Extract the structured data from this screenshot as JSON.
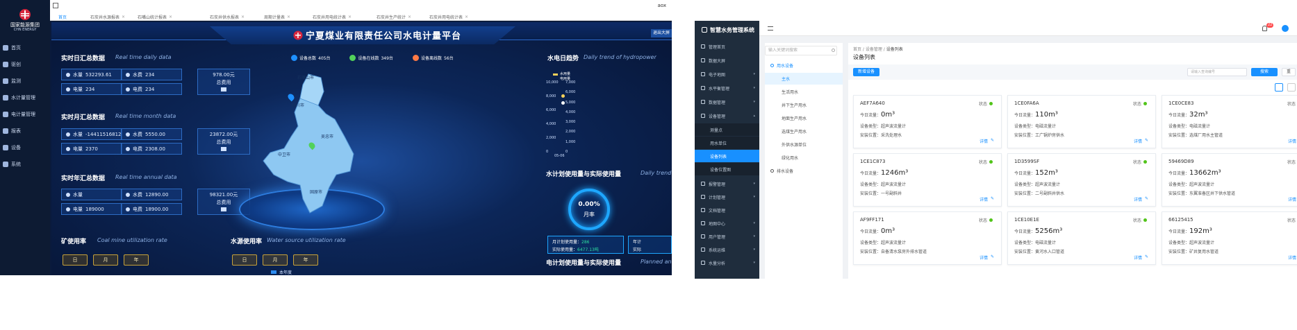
{
  "left_app": {
    "brand": {
      "logo_cn": "国家能源集团",
      "logo_en": "CHN ENERGY"
    },
    "nav": [
      {
        "label": "首页",
        "icon": "home-icon"
      },
      {
        "label": "驱创",
        "icon": "gear-icon"
      },
      {
        "label": "监测",
        "icon": "monitor-icon"
      },
      {
        "label": "水计量管理",
        "icon": "drop-icon"
      },
      {
        "label": "电计量管理",
        "icon": "meter-icon"
      },
      {
        "label": "报表",
        "icon": "report-icon"
      },
      {
        "label": "设备",
        "icon": "device-icon"
      },
      {
        "label": "系统",
        "icon": "system-icon"
      }
    ],
    "tabs": [
      {
        "label": "首页"
      },
      {
        "label": "石炭井水源报表"
      },
      {
        "label": "石嘴山统计报表"
      },
      {
        "label": "石炭井供水报表"
      },
      {
        "label": "周期计量表"
      },
      {
        "label": "石炭井用电统计表"
      },
      {
        "label": "石炭井生产统计"
      },
      {
        "label": "石炭井用电统计表"
      }
    ],
    "top_right_text": "aox",
    "dashboard": {
      "title": "宁夏煤业有限责任公司水电计量平台",
      "top_right_button": "退出大屏",
      "device_stats": [
        {
          "label": "设备总数",
          "value": "405台",
          "color": "#1e90ff"
        },
        {
          "label": "设备在线数",
          "value": "349台",
          "color": "#52d15a"
        },
        {
          "label": "设备离线数",
          "value": "56台",
          "color": "#ff7a45"
        }
      ],
      "daily": {
        "title": "实时日汇总数据",
        "subtitle": "Real time daily data",
        "water_label": "水量",
        "water_value": "532293.61",
        "water_fee_label": "水费",
        "water_fee_value": "234",
        "power_label": "电量",
        "power_value": "234",
        "power_fee_label": "电费",
        "power_fee_value": "234",
        "total_value": "978.00元",
        "total_label": "总费用"
      },
      "monthly": {
        "title": "实时月汇总数据",
        "subtitle": "Real time month data",
        "water_label": "水量",
        "water_value": "-14411516812",
        "water_fee_label": "水费",
        "water_fee_value": "5550.00",
        "power_label": "电量",
        "power_value": "2370",
        "power_fee_label": "电费",
        "power_fee_value": "2308.00",
        "total_value": "23872.00元",
        "total_label": "总费用"
      },
      "annual": {
        "title": "实时年汇总数据",
        "subtitle": "Real time annual data",
        "water_label": "水量",
        "water_value": "",
        "water_fee_label": "水费",
        "water_fee_value": "12890.00",
        "power_label": "电量",
        "power_value": "189000",
        "power_fee_label": "电费",
        "power_fee_value": "18900.00",
        "total_value": "98321.00元",
        "total_label": "总费用"
      },
      "mine_rate": {
        "title": "矿使用率",
        "subtitle": "Coal mine utilization rate",
        "buttons": [
          "日",
          "月",
          "年"
        ]
      },
      "water_source": {
        "title": "水源使用率",
        "subtitle": "Water source utilization rate",
        "buttons": [
          "日",
          "月",
          "年"
        ],
        "legend": "本年度"
      },
      "map_cities": [
        "石嘴山市",
        "银川市",
        "吴忠市",
        "中卫市",
        "固原市"
      ],
      "hydro": {
        "title": "水电日趋势",
        "subtitle": "Daily trend of hydropower",
        "legend_water": "水用量",
        "legend_power": "电用量",
        "y_left": [
          "10,000",
          "8,000",
          "6,000",
          "4,000",
          "2,000",
          "0"
        ],
        "y_right": [
          "7,000",
          "6,000",
          "5,000",
          "4,000",
          "3,000",
          "2,000",
          "1,000",
          "0"
        ],
        "x_first": "05-06"
      },
      "water_plan": {
        "title": "水计划使用量与实际使用量",
        "subtitle": "Daily trend of",
        "gauge_value": "0.00%",
        "gauge_label": "月率",
        "plan_label": "月计划使用量：",
        "plan_value": "286",
        "actual_label": "实际使用量：",
        "actual_value": "6477.13吨",
        "year_label": "年计",
        "year_actual": "实际"
      },
      "power_plan": {
        "title": "电计划使用量与实际使用量",
        "subtitle": "Planned and a"
      }
    }
  },
  "right_app": {
    "app_title": "智慧水务管理系统",
    "notify_count": "22",
    "search_placeholder": "输入关键词搜索",
    "breadcrumb": [
      "首页",
      "设备管理",
      "设备列表"
    ],
    "page_title": "设备列表",
    "add_button": "新增设备",
    "query_placeholder": "请输入查询编号",
    "query_button": "搜索",
    "reset_button": "重",
    "sidebar": [
      {
        "label": "管理首页",
        "chev": ""
      },
      {
        "label": "数据大屏",
        "chev": ""
      },
      {
        "label": "电子地图",
        "chev": "▾"
      },
      {
        "label": "水平衡管理",
        "chev": "▾"
      },
      {
        "label": "数据管理",
        "chev": "▾"
      },
      {
        "label": "设备管理",
        "chev": "▴"
      }
    ],
    "sidebar_sub": [
      {
        "label": "测量点"
      },
      {
        "label": "用水单位"
      },
      {
        "label": "设备列表"
      },
      {
        "label": "设备位置图"
      }
    ],
    "sidebar_bottom": [
      {
        "label": "报警管理",
        "chev": "▾"
      },
      {
        "label": "计划管理",
        "chev": "▾"
      },
      {
        "label": "文档管理",
        "chev": ""
      },
      {
        "label": "地图中心",
        "chev": "▾"
      },
      {
        "label": "用户管理",
        "chev": "▾"
      },
      {
        "label": "系统运维",
        "chev": "▾"
      },
      {
        "label": "水量分析",
        "chev": "▾"
      }
    ],
    "tree": [
      {
        "label": "用水设备",
        "level": 0
      },
      {
        "label": "主水",
        "level": 1
      },
      {
        "label": "生活用水",
        "level": 1
      },
      {
        "label": "井下生产用水",
        "level": 1
      },
      {
        "label": "地面生产用水",
        "level": 1
      },
      {
        "label": "选煤生产用水",
        "level": 1
      },
      {
        "label": "外供水源单位",
        "level": 1
      },
      {
        "label": "绿化用水",
        "level": 1
      },
      {
        "label": "排水设备",
        "level": 0
      }
    ],
    "cards": [
      {
        "code": "AEF7A640",
        "status": "状态",
        "today_label": "今日流量：",
        "today_value": "0m³",
        "type_label": "设备类型：",
        "type_value": "超声波流量计",
        "loc_label": "安装位置：",
        "loc_value": "采洗处理水",
        "detail": "详情"
      },
      {
        "code": "1CE0FA6A",
        "status": "状态",
        "today_label": "今日流量：",
        "today_value": "110m³",
        "type_label": "设备类型：",
        "type_value": "电磁流量计",
        "loc_label": "安装位置：",
        "loc_value": "工广锅炉房供水",
        "detail": "详情"
      },
      {
        "code": "1CE0CE83",
        "status": "状态",
        "today_label": "今日流量：",
        "today_value": "32m³",
        "type_label": "设备类型：",
        "type_value": "电磁流量计",
        "loc_label": "安装位置：",
        "loc_value": "选煤厂用水主管道",
        "detail": "详情"
      },
      {
        "code": "1CE1C873",
        "status": "状态",
        "today_label": "今日流量：",
        "today_value": "1246m³",
        "type_label": "设备类型：",
        "type_value": "超声波流量计",
        "loc_label": "安装位置：",
        "loc_value": "一号副斜井",
        "detail": "详情"
      },
      {
        "code": "1D3599SF",
        "status": "状态",
        "today_label": "今日流量：",
        "today_value": "152m³",
        "type_label": "设备类型：",
        "type_value": "超声波流量计",
        "loc_label": "安装位置：",
        "loc_value": "二号副斜井供水",
        "detail": "详情"
      },
      {
        "code": "59469D89",
        "status": "状态",
        "today_label": "今日流量：",
        "today_value": "13662m³",
        "type_label": "设备类型：",
        "type_value": "超声波流量计",
        "loc_label": "安装位置：",
        "loc_value": "东翼准备区井下供水管道",
        "detail": "详情"
      },
      {
        "code": "AF9FF171",
        "status": "状态",
        "today_label": "今日流量：",
        "today_value": "0m³",
        "type_label": "设备类型：",
        "type_value": "超声波流量计",
        "loc_label": "安装位置：",
        "loc_value": "自备清水泵房外排水管道",
        "detail": "详情"
      },
      {
        "code": "1CE10E1E",
        "status": "状态",
        "today_label": "今日流量：",
        "today_value": "5256m³",
        "type_label": "设备类型：",
        "type_value": "电磁流量计",
        "loc_label": "安装位置：",
        "loc_value": "黄河水入口管道",
        "detail": "详情"
      },
      {
        "code": "66125415",
        "status": "状态",
        "today_label": "今日流量：",
        "today_value": "192m³",
        "type_label": "设备类型：",
        "type_value": "超声波流量计",
        "loc_label": "安装位置：",
        "loc_value": "矿井复用水管道",
        "detail": "详情"
      }
    ]
  }
}
